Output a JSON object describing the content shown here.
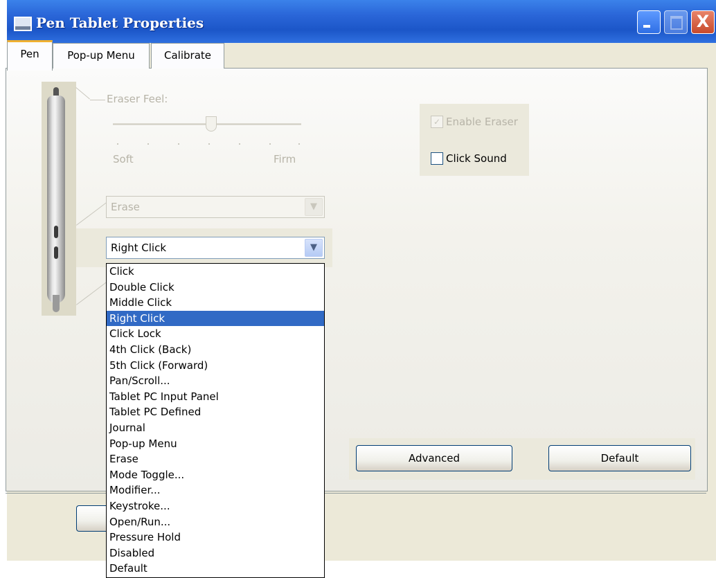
{
  "window": {
    "title": "Pen Tablet Properties",
    "close_glyph": "X"
  },
  "tabs": [
    {
      "label": "Pen",
      "active": true
    },
    {
      "label": "Pop-up Menu",
      "active": false
    },
    {
      "label": "Calibrate",
      "active": false
    }
  ],
  "eraser": {
    "label": "Eraser Feel:",
    "soft_label": "Soft",
    "firm_label": "Firm",
    "slider_level": 0.5
  },
  "options": {
    "enable_eraser_label": "Enable Eraser",
    "enable_eraser_checked": true,
    "click_sound_label": "Click Sound",
    "click_sound_checked": false
  },
  "upper_button": {
    "value": "Erase"
  },
  "lower_button": {
    "value": "Right Click"
  },
  "dropdown": {
    "items": [
      "Click",
      "Double Click",
      "Middle Click",
      "Right Click",
      "Click Lock",
      "4th Click (Back)",
      "5th Click (Forward)",
      "Pan/Scroll...",
      "Tablet PC Input Panel",
      "Tablet PC Defined",
      "Journal",
      "Pop-up Menu",
      "Erase",
      "Mode Toggle...",
      "Modifier...",
      "Keystroke...",
      "Open/Run...",
      "Pressure Hold",
      "Disabled",
      "Default"
    ],
    "selected": "Right Click"
  },
  "buttons": {
    "advanced": "Advanced",
    "default": "Default"
  },
  "colors": {
    "title_bar": "#2a66d8",
    "selection": "#316ac5",
    "dialog_bg": "#ece9d8"
  }
}
